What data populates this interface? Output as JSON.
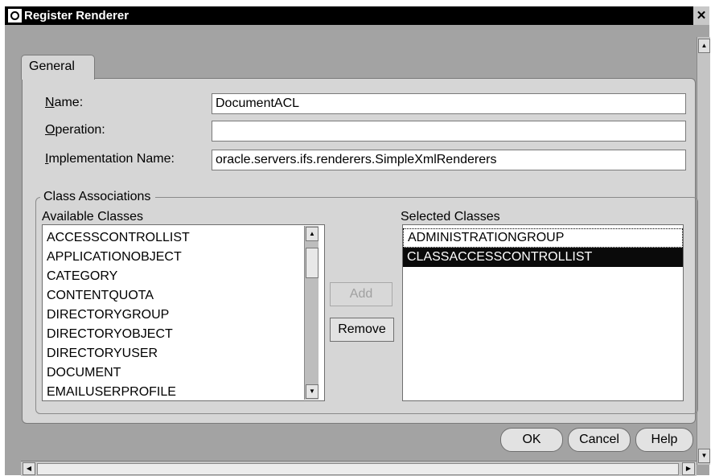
{
  "window": {
    "title": "Register Renderer",
    "close_glyph": "✕"
  },
  "tabs": [
    {
      "label": "General"
    }
  ],
  "form": {
    "name": {
      "label_u": "N",
      "label_rest": "ame:",
      "value": "DocumentACL"
    },
    "operation": {
      "label_u": "O",
      "label_rest": "peration:",
      "value": ""
    },
    "implementation": {
      "label_u": "I",
      "label_rest": "mplementation Name:",
      "value": "oracle.servers.ifs.renderers.SimpleXmlRenderers"
    }
  },
  "class_associations": {
    "title": "Class Associations",
    "available_label": "Available Classes",
    "selected_label": "Selected Classes",
    "available": [
      "ACCESSCONTROLLIST",
      "APPLICATIONOBJECT",
      "CATEGORY",
      "CONTENTQUOTA",
      "DIRECTORYGROUP",
      "DIRECTORYOBJECT",
      "DIRECTORYUSER",
      "DOCUMENT",
      "EMAILUSERPROFILE"
    ],
    "selected": [
      "ADMINISTRATIONGROUP",
      "CLASSACCESSCONTROLLIST"
    ],
    "selected_index": 1,
    "add_label": "Add",
    "remove_label": "Remove"
  },
  "buttons": {
    "ok": "OK",
    "cancel": "Cancel",
    "help": "Help"
  },
  "colors": {
    "background": "#a3a3a3",
    "panel": "#d6d6d6",
    "title_bar": "#000000",
    "selection": "#0a0a0a"
  }
}
